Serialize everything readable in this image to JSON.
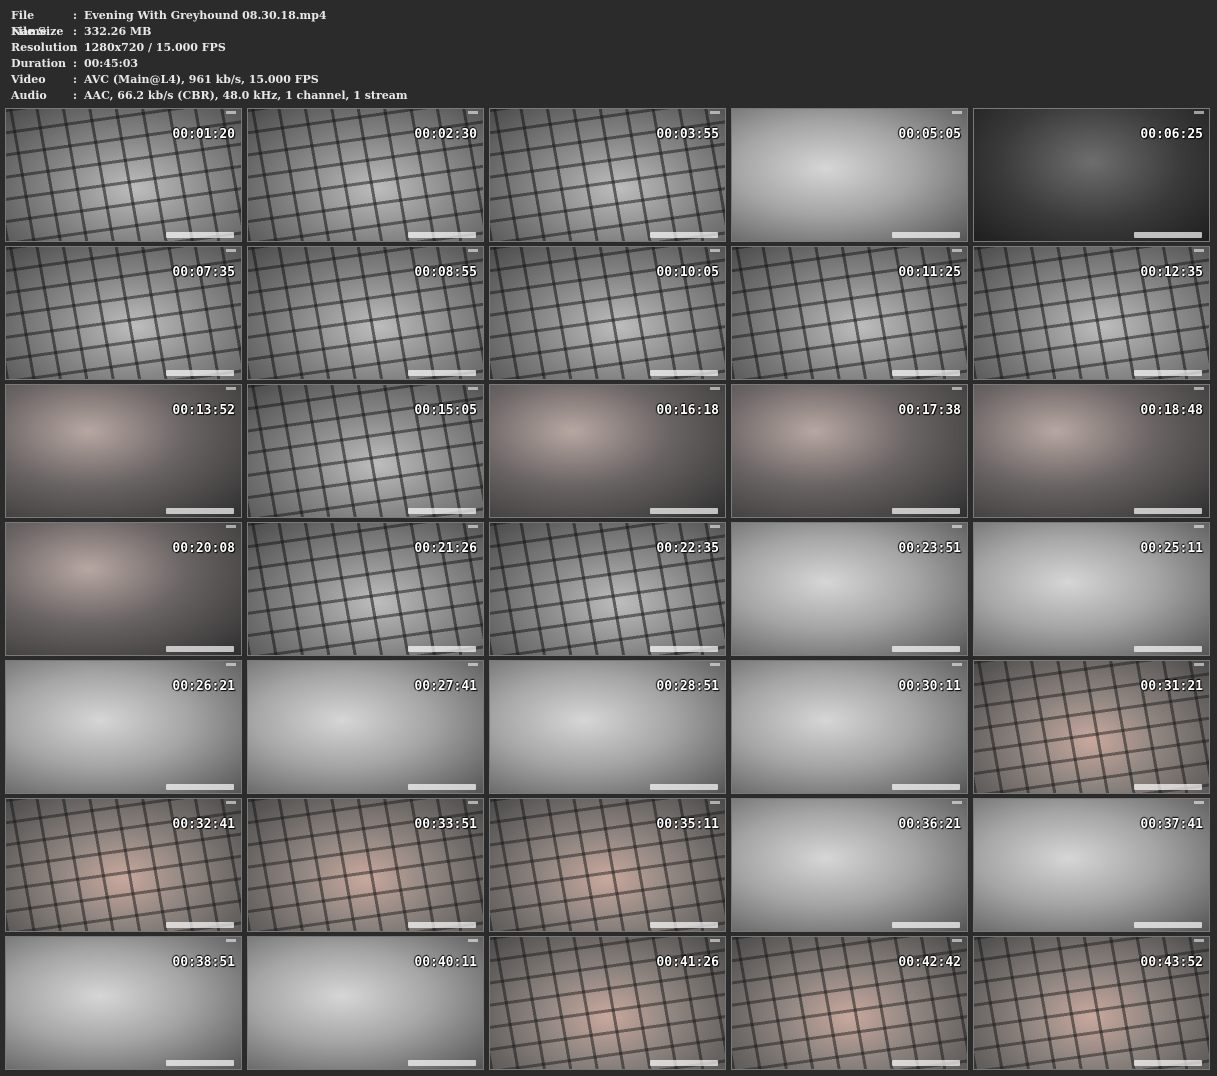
{
  "info": {
    "rows": [
      {
        "key": "File Name",
        "value": "Evening With Greyhound 08.30.18.mp4"
      },
      {
        "key": "File Size",
        "value": "332.26 MB"
      },
      {
        "key": "Resolution",
        "value": "1280x720 / 15.000 FPS"
      },
      {
        "key": "Duration",
        "value": "00:45:03"
      },
      {
        "key": "Video",
        "value": "AVC (Main@L4), 961 kb/s, 15.000 FPS"
      },
      {
        "key": "Audio",
        "value": "AAC, 66.2 kb/s (CBR), 48.0 kHz, 1 channel, 1 stream"
      }
    ],
    "separator": ":"
  },
  "thumbnails": [
    {
      "time": "00:01:20",
      "tone": "cage"
    },
    {
      "time": "00:02:30",
      "tone": "cage"
    },
    {
      "time": "00:03:55",
      "tone": "cage"
    },
    {
      "time": "00:05:05",
      "tone": "bed"
    },
    {
      "time": "00:06:25",
      "tone": "dark"
    },
    {
      "time": "00:07:35",
      "tone": "cage"
    },
    {
      "time": "00:08:55",
      "tone": "cage"
    },
    {
      "time": "00:10:05",
      "tone": "cage"
    },
    {
      "time": "00:11:25",
      "tone": "cage"
    },
    {
      "time": "00:12:35",
      "tone": "cage"
    },
    {
      "time": "00:13:52",
      "tone": "floor"
    },
    {
      "time": "00:15:05",
      "tone": "cage"
    },
    {
      "time": "00:16:18",
      "tone": "floor"
    },
    {
      "time": "00:17:38",
      "tone": "floor"
    },
    {
      "time": "00:18:48",
      "tone": "floor"
    },
    {
      "time": "00:20:08",
      "tone": "floor"
    },
    {
      "time": "00:21:26",
      "tone": "cage"
    },
    {
      "time": "00:22:35",
      "tone": "cage"
    },
    {
      "time": "00:23:51",
      "tone": "bed"
    },
    {
      "time": "00:25:11",
      "tone": "bed"
    },
    {
      "time": "00:26:21",
      "tone": "bed"
    },
    {
      "time": "00:27:41",
      "tone": "bed"
    },
    {
      "time": "00:28:51",
      "tone": "bed"
    },
    {
      "time": "00:30:11",
      "tone": "bed"
    },
    {
      "time": "00:31:21",
      "tone": "warm"
    },
    {
      "time": "00:32:41",
      "tone": "warm"
    },
    {
      "time": "00:33:51",
      "tone": "warm"
    },
    {
      "time": "00:35:11",
      "tone": "warm"
    },
    {
      "time": "00:36:21",
      "tone": "bed"
    },
    {
      "time": "00:37:41",
      "tone": "bed"
    },
    {
      "time": "00:38:51",
      "tone": "bed"
    },
    {
      "time": "00:40:11",
      "tone": "bed"
    },
    {
      "time": "00:41:26",
      "tone": "warm"
    },
    {
      "time": "00:42:42",
      "tone": "warm"
    },
    {
      "time": "00:43:52",
      "tone": "warm"
    }
  ]
}
